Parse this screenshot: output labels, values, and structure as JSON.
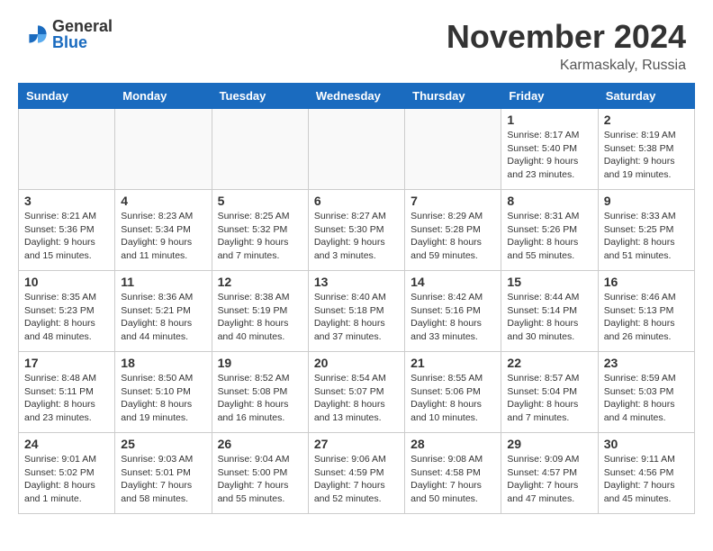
{
  "header": {
    "logo_general": "General",
    "logo_blue": "Blue",
    "month_title": "November 2024",
    "location": "Karmaskaly, Russia"
  },
  "weekdays": [
    "Sunday",
    "Monday",
    "Tuesday",
    "Wednesday",
    "Thursday",
    "Friday",
    "Saturday"
  ],
  "weeks": [
    [
      {
        "day": "",
        "info": "",
        "empty": true
      },
      {
        "day": "",
        "info": "",
        "empty": true
      },
      {
        "day": "",
        "info": "",
        "empty": true
      },
      {
        "day": "",
        "info": "",
        "empty": true
      },
      {
        "day": "",
        "info": "",
        "empty": true
      },
      {
        "day": "1",
        "info": "Sunrise: 8:17 AM\nSunset: 5:40 PM\nDaylight: 9 hours\nand 23 minutes."
      },
      {
        "day": "2",
        "info": "Sunrise: 8:19 AM\nSunset: 5:38 PM\nDaylight: 9 hours\nand 19 minutes."
      }
    ],
    [
      {
        "day": "3",
        "info": "Sunrise: 8:21 AM\nSunset: 5:36 PM\nDaylight: 9 hours\nand 15 minutes."
      },
      {
        "day": "4",
        "info": "Sunrise: 8:23 AM\nSunset: 5:34 PM\nDaylight: 9 hours\nand 11 minutes."
      },
      {
        "day": "5",
        "info": "Sunrise: 8:25 AM\nSunset: 5:32 PM\nDaylight: 9 hours\nand 7 minutes."
      },
      {
        "day": "6",
        "info": "Sunrise: 8:27 AM\nSunset: 5:30 PM\nDaylight: 9 hours\nand 3 minutes."
      },
      {
        "day": "7",
        "info": "Sunrise: 8:29 AM\nSunset: 5:28 PM\nDaylight: 8 hours\nand 59 minutes."
      },
      {
        "day": "8",
        "info": "Sunrise: 8:31 AM\nSunset: 5:26 PM\nDaylight: 8 hours\nand 55 minutes."
      },
      {
        "day": "9",
        "info": "Sunrise: 8:33 AM\nSunset: 5:25 PM\nDaylight: 8 hours\nand 51 minutes."
      }
    ],
    [
      {
        "day": "10",
        "info": "Sunrise: 8:35 AM\nSunset: 5:23 PM\nDaylight: 8 hours\nand 48 minutes."
      },
      {
        "day": "11",
        "info": "Sunrise: 8:36 AM\nSunset: 5:21 PM\nDaylight: 8 hours\nand 44 minutes."
      },
      {
        "day": "12",
        "info": "Sunrise: 8:38 AM\nSunset: 5:19 PM\nDaylight: 8 hours\nand 40 minutes."
      },
      {
        "day": "13",
        "info": "Sunrise: 8:40 AM\nSunset: 5:18 PM\nDaylight: 8 hours\nand 37 minutes."
      },
      {
        "day": "14",
        "info": "Sunrise: 8:42 AM\nSunset: 5:16 PM\nDaylight: 8 hours\nand 33 minutes."
      },
      {
        "day": "15",
        "info": "Sunrise: 8:44 AM\nSunset: 5:14 PM\nDaylight: 8 hours\nand 30 minutes."
      },
      {
        "day": "16",
        "info": "Sunrise: 8:46 AM\nSunset: 5:13 PM\nDaylight: 8 hours\nand 26 minutes."
      }
    ],
    [
      {
        "day": "17",
        "info": "Sunrise: 8:48 AM\nSunset: 5:11 PM\nDaylight: 8 hours\nand 23 minutes."
      },
      {
        "day": "18",
        "info": "Sunrise: 8:50 AM\nSunset: 5:10 PM\nDaylight: 8 hours\nand 19 minutes."
      },
      {
        "day": "19",
        "info": "Sunrise: 8:52 AM\nSunset: 5:08 PM\nDaylight: 8 hours\nand 16 minutes."
      },
      {
        "day": "20",
        "info": "Sunrise: 8:54 AM\nSunset: 5:07 PM\nDaylight: 8 hours\nand 13 minutes."
      },
      {
        "day": "21",
        "info": "Sunrise: 8:55 AM\nSunset: 5:06 PM\nDaylight: 8 hours\nand 10 minutes."
      },
      {
        "day": "22",
        "info": "Sunrise: 8:57 AM\nSunset: 5:04 PM\nDaylight: 8 hours\nand 7 minutes."
      },
      {
        "day": "23",
        "info": "Sunrise: 8:59 AM\nSunset: 5:03 PM\nDaylight: 8 hours\nand 4 minutes."
      }
    ],
    [
      {
        "day": "24",
        "info": "Sunrise: 9:01 AM\nSunset: 5:02 PM\nDaylight: 8 hours\nand 1 minute."
      },
      {
        "day": "25",
        "info": "Sunrise: 9:03 AM\nSunset: 5:01 PM\nDaylight: 7 hours\nand 58 minutes."
      },
      {
        "day": "26",
        "info": "Sunrise: 9:04 AM\nSunset: 5:00 PM\nDaylight: 7 hours\nand 55 minutes."
      },
      {
        "day": "27",
        "info": "Sunrise: 9:06 AM\nSunset: 4:59 PM\nDaylight: 7 hours\nand 52 minutes."
      },
      {
        "day": "28",
        "info": "Sunrise: 9:08 AM\nSunset: 4:58 PM\nDaylight: 7 hours\nand 50 minutes."
      },
      {
        "day": "29",
        "info": "Sunrise: 9:09 AM\nSunset: 4:57 PM\nDaylight: 7 hours\nand 47 minutes."
      },
      {
        "day": "30",
        "info": "Sunrise: 9:11 AM\nSunset: 4:56 PM\nDaylight: 7 hours\nand 45 minutes."
      }
    ]
  ]
}
